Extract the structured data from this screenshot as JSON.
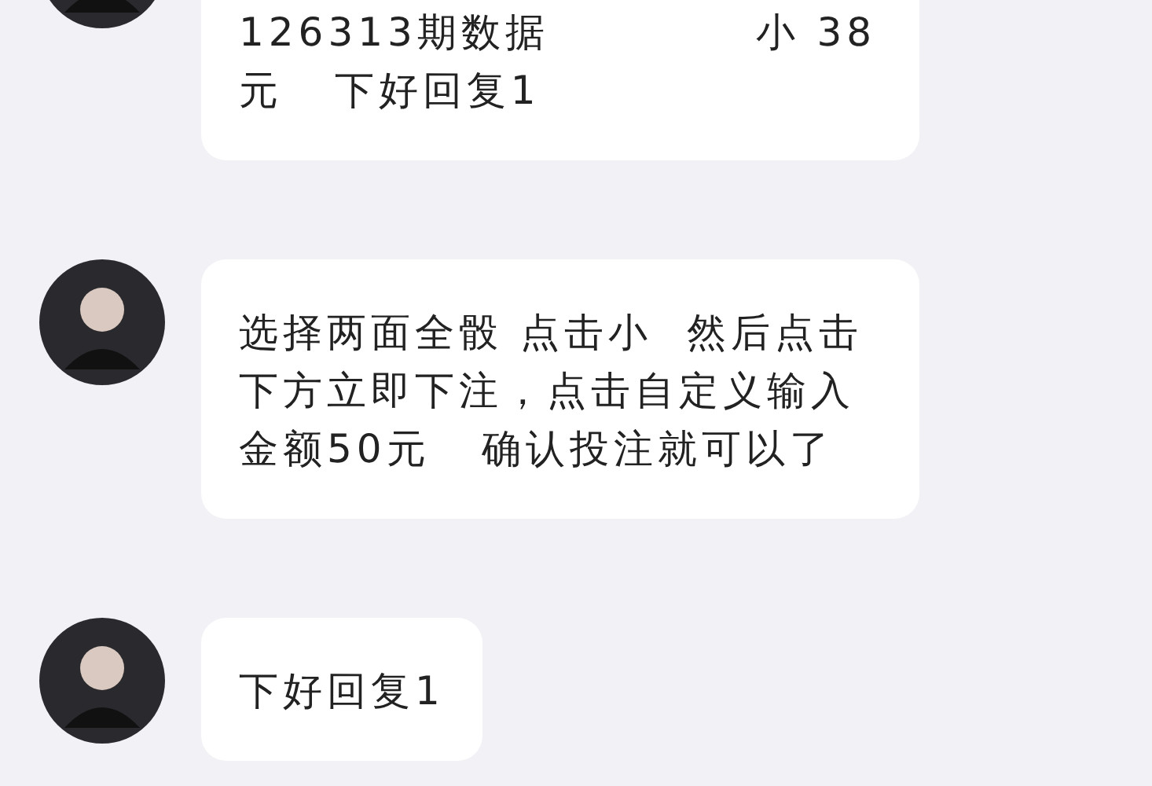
{
  "messages": [
    {
      "text": "126313期数据            小 38元   下好回复1"
    },
    {
      "text": "选择两面全骰 点击小  然后点击下方立即下注，点击自定义输入金额50元   确认投注就可以了"
    },
    {
      "text": "下好回复1"
    }
  ]
}
